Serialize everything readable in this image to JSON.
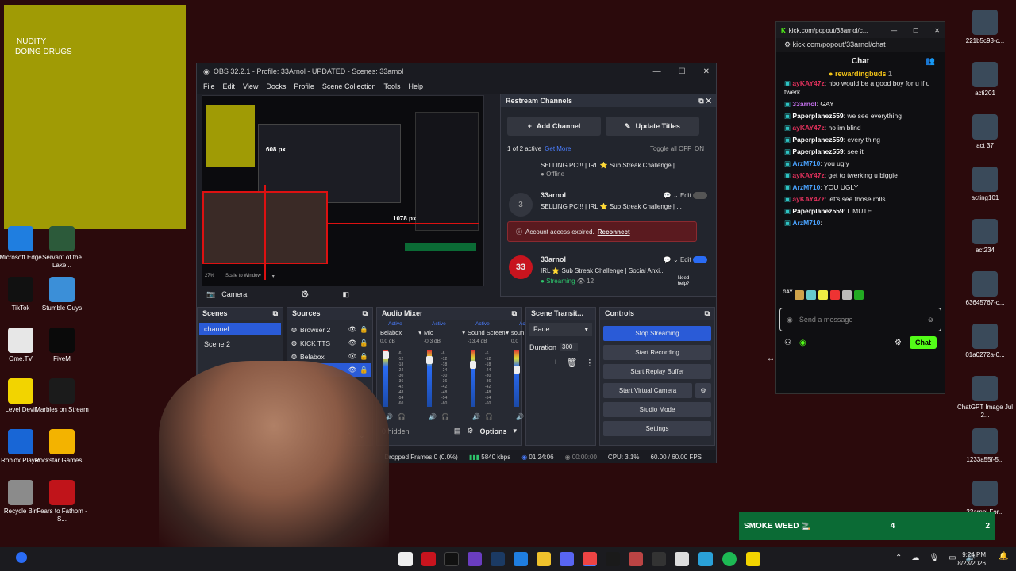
{
  "sticky": {
    "line1": "NUDITY",
    "line2": "DOING DRUGS"
  },
  "desktop_left": [
    {
      "label": "Microsoft Edge",
      "icon": "edge-icon",
      "color": "#1f7ee0"
    },
    {
      "label": "Servant of the Lake...",
      "icon": "game-icon",
      "color": "#2c5a3a"
    },
    {
      "label": "TikTok",
      "icon": "tiktok-icon",
      "color": "#111111"
    },
    {
      "label": "Stumble Guys",
      "icon": "stumble-icon",
      "color": "#3b8fd8"
    },
    {
      "label": "Ome.TV",
      "icon": "ometv-icon",
      "color": "#e7e7e7"
    },
    {
      "label": "FiveM",
      "icon": "fivem-icon",
      "color": "#0a0a0a"
    },
    {
      "label": "Level Devil",
      "icon": "leveldevil-icon",
      "color": "#f2d400"
    },
    {
      "label": "Marbles on Stream",
      "icon": "marbles-icon",
      "color": "#1b1b1b"
    },
    {
      "label": "Roblox Player",
      "icon": "roblox-icon",
      "color": "#1866d6"
    },
    {
      "label": "Rockstar Games ...",
      "icon": "rockstar-icon",
      "color": "#f3b300"
    },
    {
      "label": "Recycle Bin",
      "icon": "recycle-bin-icon",
      "color": "#8b8b8b"
    },
    {
      "label": "Fears to Fathom - S...",
      "icon": "game-icon",
      "color": "#c0141a"
    }
  ],
  "desktop_right": [
    {
      "label": "221b5c93-c..."
    },
    {
      "label": "acti201"
    },
    {
      "label": "act 37"
    },
    {
      "label": "acting101"
    },
    {
      "label": "act234"
    },
    {
      "label": "63645767-c..."
    },
    {
      "label": "01a0272a-0..."
    },
    {
      "label": "ChatGPT Image Jul 2..."
    },
    {
      "label": "1233a55f-5..."
    },
    {
      "label": "33arnol For..."
    }
  ],
  "obs": {
    "title": "OBS 32.2.1 - Profile: 33Arnol - UPDATED - Scenes: 33arnol",
    "menu": [
      "File",
      "Edit",
      "View",
      "Docks",
      "Profile",
      "Scene Collection",
      "Tools",
      "Help"
    ],
    "preview_labels": {
      "a": "608 px",
      "b": "1078 px"
    },
    "preview_bar": {
      "zoom": "27%",
      "scale": "Scale to Window"
    },
    "camera_label": "Camera",
    "restream": {
      "title": "Restream Channels",
      "add_channel": "Add Channel",
      "update_titles": "Update Titles",
      "active_text": "1 of 2 active",
      "get_more": "Get More",
      "toggle_all": "Toggle all OFF",
      "toggle_on": "ON",
      "channels": [
        {
          "name": "",
          "title": "SELLING PC!!! | IRL ⭐ Sub Streak Challenge | ...",
          "status": "Offline"
        },
        {
          "name": "33arnol",
          "title": "SELLING PC!!! | IRL ⭐ Sub Streak Challenge | ...",
          "status": ""
        },
        {
          "name": "33arnol",
          "title": "IRL ⭐ Sub Streak Challenge | Social Anxi...",
          "status": "Streaming",
          "viewers": "12"
        }
      ],
      "edit": "Edit",
      "error": "Account access expired.",
      "reconnect": "Reconnect",
      "need_help": "Need help?"
    },
    "scenes": {
      "title": "Scenes",
      "items": [
        "channel",
        "Scene 2"
      ]
    },
    "sources": {
      "title": "Sources",
      "items": [
        "Browser 2",
        "KICK TTS",
        "Belabox",
        "Camera"
      ]
    },
    "mixer": {
      "title": "Audio Mixer",
      "channels": [
        {
          "status": "Active",
          "name": "Belabox",
          "db": "0.0 dB"
        },
        {
          "status": "Active",
          "name": "Mic",
          "db": "-0.3 dB"
        },
        {
          "status": "Active",
          "name": "Sound Screen",
          "db": "-13.4 dB"
        },
        {
          "status": "Active",
          "name": "soun",
          "db": "0.0"
        }
      ],
      "ticks": [
        "-6",
        "-12",
        "-18",
        "-24",
        "-30",
        "-36",
        "-42",
        "-48",
        "-54",
        "-60"
      ],
      "hidden": "0 hidden",
      "options": "Options"
    },
    "transitions": {
      "title": "Scene Transit...",
      "fade": "Fade",
      "duration_label": "Duration",
      "duration": "300 i"
    },
    "controls": {
      "title": "Controls",
      "buttons": [
        "Stop Streaming",
        "Start Recording",
        "Start Replay Buffer",
        "Start Virtual Camera",
        "Studio Mode",
        "Settings"
      ]
    },
    "status": {
      "dropped": "Dropped Frames 0 (0.0%)",
      "kbps": "5840 kbps",
      "time": "01:24:06",
      "rec": "00:00:00",
      "cpu": "CPU: 3.1%",
      "fps": "60.00 / 60.00 FPS"
    }
  },
  "chat": {
    "tab_title": "kick.com/popout/33arnol/c...",
    "url": "kick.com/popout/33arnol/chat",
    "header": "Chat",
    "pinned": "rewardingbuds",
    "pinned_count": "1",
    "messages": [
      {
        "user": "ayKAY47z",
        "text": "nbo would be a good boy for u if u twerk",
        "color": "#e0315c"
      },
      {
        "user": "33arnol",
        "text": "GAY",
        "color": "#c471ed"
      },
      {
        "user": "Paperplanez559",
        "text": "we see everything",
        "color": "#ffffff"
      },
      {
        "user": "ayKAY47z",
        "text": "no im blind",
        "color": "#e0315c"
      },
      {
        "user": "Paperplanez559",
        "text": "every thing",
        "color": "#ffffff"
      },
      {
        "user": "Paperplanez559",
        "text": "see it",
        "color": "#ffffff"
      },
      {
        "user": "ArzM710",
        "text": "you ugly",
        "color": "#4aa3ff"
      },
      {
        "user": "ayKAY47z",
        "text": "get to twerking u biggie",
        "color": "#e0315c"
      },
      {
        "user": "ArzM710",
        "text": "YOU UGLY",
        "color": "#4aa3ff"
      },
      {
        "user": "ayKAY47z",
        "text": "let's see those rolls",
        "color": "#e0315c"
      },
      {
        "user": "Paperplanez559",
        "text": "L MUTE",
        "color": "#ffffff"
      },
      {
        "user": "ArzM710",
        "text": "",
        "color": "#4aa3ff"
      }
    ],
    "emote_label": "GAY",
    "placeholder": "Send a message",
    "send": "Chat"
  },
  "banner": {
    "text": "SMOKE WEED 🚬",
    "n1": "4",
    "n2": "2"
  },
  "clock": {
    "time": "9:24 PM",
    "date": "8/23/2026"
  }
}
